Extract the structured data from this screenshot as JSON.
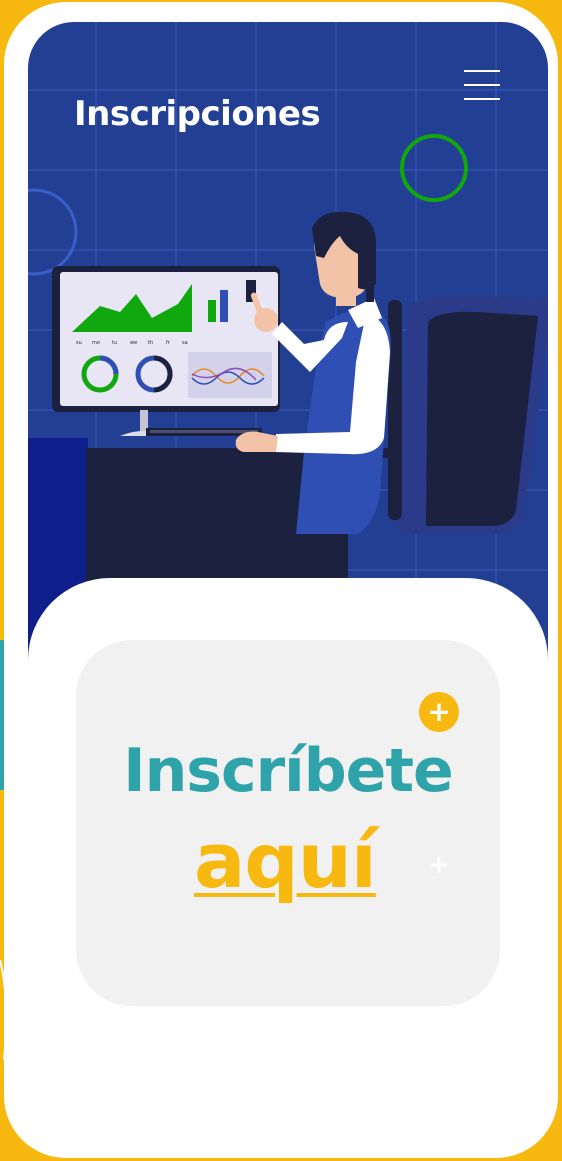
{
  "header": {
    "title": "Inscripciones",
    "menu_icon": "hamburger-menu-icon"
  },
  "hero": {
    "illustration": "person-analyzing-dashboard-illustration",
    "chart_day_labels": [
      "su",
      "mo",
      "tu",
      "we",
      "th",
      "fr",
      "sa"
    ]
  },
  "cta": {
    "line1": "Inscríbete",
    "line2": "aquí",
    "plus_badge": "+",
    "plus_small": "+"
  },
  "colors": {
    "brand_yellow": "#f7b90f",
    "hero_blue": "#233f93",
    "teal": "#2fa3aa",
    "green": "#11a80f",
    "card_gray": "#f1f1f1"
  }
}
